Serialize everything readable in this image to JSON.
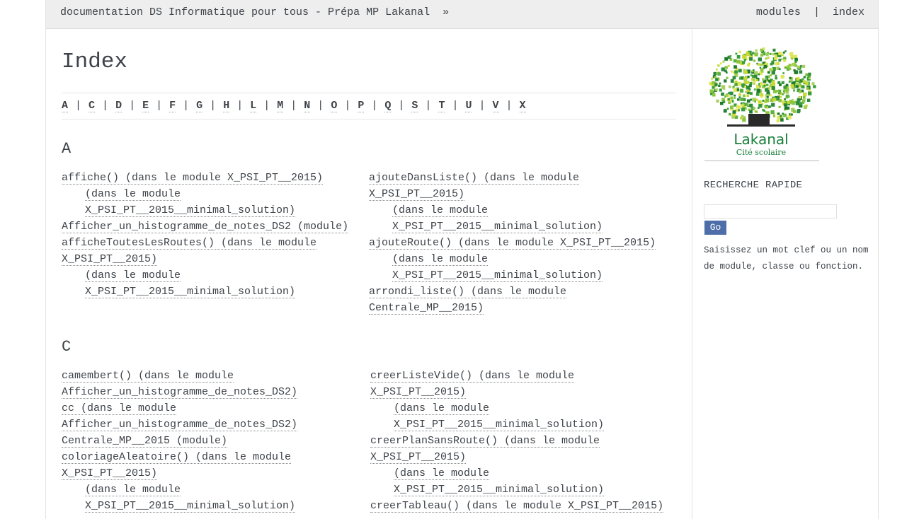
{
  "topbar": {
    "title": "documentation DS Informatique pour tous - Prépa MP Lakanal",
    "raquo": "»",
    "modules": "modules",
    "separator": "|",
    "index": "index"
  },
  "main": {
    "heading": "Index",
    "letters": [
      "A",
      "C",
      "D",
      "E",
      "F",
      "G",
      "H",
      "L",
      "M",
      "N",
      "O",
      "P",
      "Q",
      "S",
      "T",
      "U",
      "V",
      "X"
    ],
    "sections": [
      {
        "letter": "A",
        "left": [
          {
            "text": "affiche() (dans le module X_PSI_PT__2015)",
            "indent": false
          },
          {
            "text": "(dans le module",
            "indent": true
          },
          {
            "text": "X_PSI_PT__2015__minimal_solution)",
            "indent": true
          },
          {
            "text": "Afficher_un_histogramme_de_notes_DS2 (module)",
            "indent": false
          },
          {
            "text": "afficheToutesLesRoutes() (dans le module",
            "indent": false
          },
          {
            "text": "X_PSI_PT__2015)",
            "indent": false
          },
          {
            "text": "(dans le module",
            "indent": true
          },
          {
            "text": "X_PSI_PT__2015__minimal_solution)",
            "indent": true
          }
        ],
        "right": [
          {
            "text": "ajouteDansListe() (dans le module",
            "indent": false
          },
          {
            "text": "X_PSI_PT__2015)",
            "indent": false
          },
          {
            "text": "(dans le module",
            "indent": true
          },
          {
            "text": "X_PSI_PT__2015__minimal_solution)",
            "indent": true
          },
          {
            "text": "ajouteRoute() (dans le module X_PSI_PT__2015)",
            "indent": false
          },
          {
            "text": "(dans le module",
            "indent": true
          },
          {
            "text": "X_PSI_PT__2015__minimal_solution)",
            "indent": true
          },
          {
            "text": "arrondi_liste() (dans le module",
            "indent": false
          },
          {
            "text": "Centrale_MP__2015)",
            "indent": false
          }
        ]
      },
      {
        "letter": "C",
        "left": [
          {
            "text": "camembert() (dans le module",
            "indent": false
          },
          {
            "text": "Afficher_un_histogramme_de_notes_DS2)",
            "indent": false
          },
          {
            "text": "cc (dans le module",
            "indent": false
          },
          {
            "text": "Afficher_un_histogramme_de_notes_DS2)",
            "indent": false
          },
          {
            "text": "Centrale_MP__2015 (module)",
            "indent": false
          },
          {
            "text": "coloriageAleatoire() (dans le module",
            "indent": false
          },
          {
            "text": "X_PSI_PT__2015)",
            "indent": false
          },
          {
            "text": "(dans le module",
            "indent": true
          },
          {
            "text": "X_PSI_PT__2015__minimal_solution)",
            "indent": true
          }
        ],
        "right": [
          {
            "text": "creerListeVide() (dans le module",
            "indent": false
          },
          {
            "text": "X_PSI_PT__2015)",
            "indent": false
          },
          {
            "text": "(dans le module",
            "indent": true
          },
          {
            "text": "X_PSI_PT__2015__minimal_solution)",
            "indent": true
          },
          {
            "text": "creerPlanSansRoute() (dans le module",
            "indent": false
          },
          {
            "text": "X_PSI_PT__2015)",
            "indent": false
          },
          {
            "text": "(dans le module",
            "indent": true
          },
          {
            "text": "X_PSI_PT__2015__minimal_solution)",
            "indent": true
          },
          {
            "text": "creerTableau() (dans le module X_PSI_PT__2015)",
            "indent": false
          }
        ]
      }
    ]
  },
  "sidebar": {
    "logo_text": "Lakanal",
    "logo_subtext": "Cité scolaire",
    "search_title": "RECHERCHE RAPIDE",
    "search_value": "",
    "go_label": "Go",
    "hint_line1": "Saisissez un mot clef ou un nom",
    "hint_line2": "de module, classe ou fonction."
  },
  "colors": {
    "text": "#3e4349",
    "topbar_bg": "#eeeeee",
    "button_bg": "#4d6ea8",
    "logo_green": "#1a7f3a"
  }
}
